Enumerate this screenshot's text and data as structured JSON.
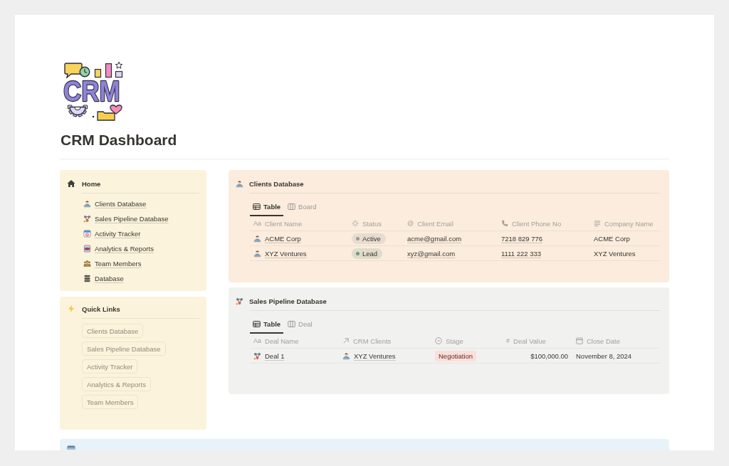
{
  "logo": {
    "text": "CRM"
  },
  "page": {
    "title": "CRM Dashboard"
  },
  "home": {
    "title": "Home",
    "items": [
      "Clients Database",
      "Sales Pipeline Database",
      "Activity Tracker",
      "Analytics & Reports",
      "Team Members",
      "Database"
    ]
  },
  "quick_links": {
    "title": "Quick Links",
    "items": [
      "Clients Database",
      "Sales Pipeline Database",
      "Activity Tracker",
      "Analytics & Reports",
      "Team Members"
    ]
  },
  "clients_database": {
    "title": "Clients Database",
    "tabs": [
      {
        "label": "Table",
        "selected": true
      },
      {
        "label": "Board",
        "selected": false
      }
    ],
    "columns": [
      {
        "glyph": "Aa",
        "label": "Client Name"
      },
      {
        "label": "Status"
      },
      {
        "glyph": "@",
        "label": "Client Email"
      },
      {
        "label": "Client Phone No"
      },
      {
        "label": "Company Name"
      }
    ],
    "rows": [
      {
        "client_name": "ACME Corp",
        "status": {
          "label": "Active",
          "color": "#9b9a97"
        },
        "client_email": "acme@gmail.com",
        "client_phone_no": "7218 829 776",
        "company_name": "ACME Corp"
      },
      {
        "client_name": "XYZ Ventures",
        "status": {
          "label": "Lead",
          "color": "#6c9b7d"
        },
        "client_email": "xyz@gmail.com",
        "client_phone_no": "1111 222 333",
        "company_name": "XYZ Ventures"
      }
    ]
  },
  "sales_pipeline_database": {
    "title": "Sales Pipeline Database",
    "tabs": [
      {
        "label": "Table",
        "selected": true
      },
      {
        "label": "Deal",
        "selected": false
      }
    ],
    "columns": [
      {
        "glyph": "Aa",
        "label": "Deal Name"
      },
      {
        "label": "CRM Clients"
      },
      {
        "label": "Stage"
      },
      {
        "glyph": "#",
        "label": "Deal Value"
      },
      {
        "label": "Close Date"
      }
    ],
    "rows": [
      {
        "deal_name": "Deal 1",
        "crm_clients": "XYZ Ventures",
        "stage": "Negotiation",
        "deal_value": "$100,000.00",
        "close_date": "November 8, 2024"
      }
    ]
  }
}
